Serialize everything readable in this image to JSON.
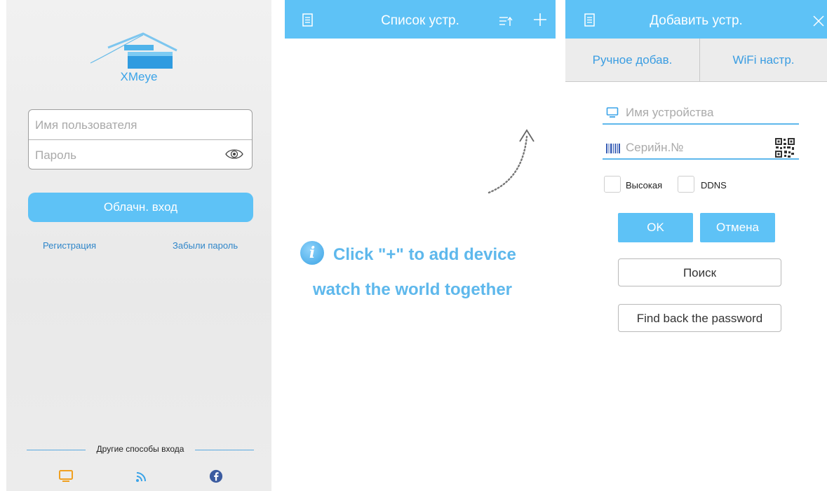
{
  "login": {
    "brand": "XMeye",
    "username_placeholder": "Имя пользователя",
    "password_placeholder": "Пароль",
    "login_button": "Облачн. вход",
    "register_link": "Регистрация",
    "forgot_link": "Забыли пароль",
    "other_methods": "Другие способы входа",
    "social_icons": [
      "monitor-icon",
      "wifi-icon",
      "facebook-icon"
    ]
  },
  "device_list": {
    "title": "Список устр.",
    "hint_line1": "Click \"+\" to add device",
    "hint_line2": "watch the world together",
    "icons": [
      "menu-icon",
      "sort-icon",
      "plus-icon"
    ]
  },
  "add_device": {
    "title": "Добавить устр.",
    "tab_manual": "Ручное добав.",
    "tab_wifi": "WiFi настр.",
    "device_name_placeholder": "Имя устройства",
    "serial_placeholder": "Серийн.№",
    "checkbox_high": "Высокая",
    "checkbox_ddns": "DDNS",
    "ok_button": "OK",
    "cancel_button": "Отмена",
    "search_button": "Поиск",
    "find_password_button": "Find back the password"
  },
  "colors": {
    "accent": "#5ec2f6",
    "link": "#2f86c9",
    "hint_text": "#5eb8ec",
    "facebook": "#3b5ba0",
    "monitor": "#f0a020"
  }
}
